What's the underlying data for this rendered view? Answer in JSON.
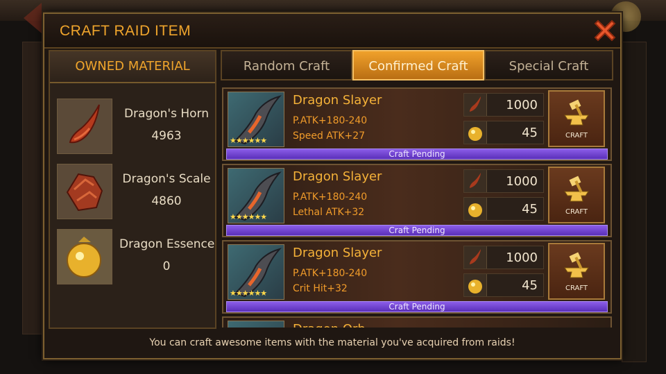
{
  "dialog": {
    "title": "CRAFT RAID ITEM"
  },
  "materials": {
    "header": "OWNED MATERIAL",
    "items": [
      {
        "name": "Dragon's Horn",
        "count": "4963",
        "icon": "dragon-horn-icon"
      },
      {
        "name": "Dragon's Scale",
        "count": "4860",
        "icon": "dragon-scale-icon"
      },
      {
        "name": "Dragon Essence",
        "count": "0",
        "icon": "dragon-essence-icon"
      }
    ]
  },
  "tabs": [
    {
      "label": "Random Craft",
      "active": false
    },
    {
      "label": "Confirmed Craft",
      "active": true
    },
    {
      "label": "Special Craft",
      "active": false
    }
  ],
  "recipes": [
    {
      "name": "Dragon Slayer",
      "stat1": "P.ATK+180-240",
      "stat2": "Speed ATK+27",
      "stars": "★★★★★★",
      "horn_cost": "1000",
      "essence_cost": "45",
      "craft_label": "CRAFT",
      "status": "Craft Pending"
    },
    {
      "name": "Dragon Slayer",
      "stat1": "P.ATK+180-240",
      "stat2": "Lethal ATK+32",
      "stars": "★★★★★★",
      "horn_cost": "1000",
      "essence_cost": "45",
      "craft_label": "CRAFT",
      "status": "Craft Pending"
    },
    {
      "name": "Dragon Slayer",
      "stat1": "P.ATK+180-240",
      "stat2": "Crit Hit+32",
      "stars": "★★★★★★",
      "horn_cost": "1000",
      "essence_cost": "45",
      "craft_label": "CRAFT",
      "status": "Craft Pending"
    },
    {
      "name": "Dragon Orb"
    }
  ],
  "footer": {
    "hint": "You can craft awesome items with the material you've acquired from raids!"
  },
  "colors": {
    "accent": "#f0a52c",
    "active_tab": "#e59a27",
    "pending": "#6b3ed0",
    "close": "#e8572c"
  }
}
